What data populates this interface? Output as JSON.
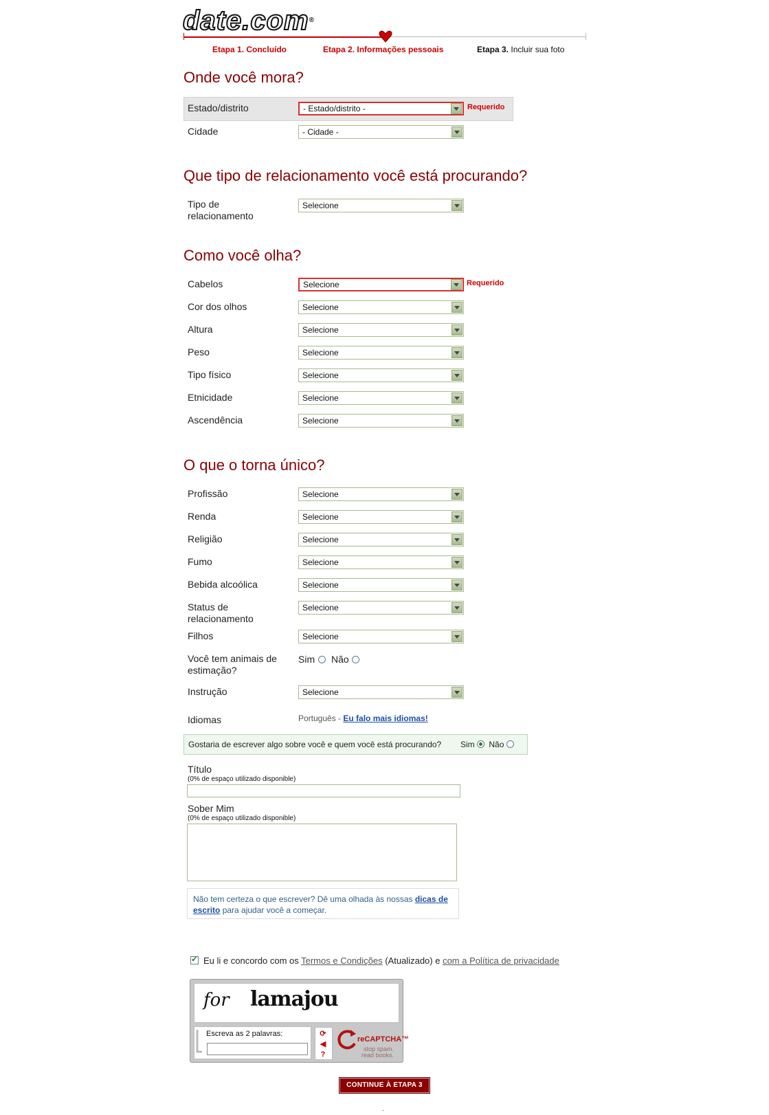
{
  "brand": {
    "logo_text": "date.com",
    "reg_mark": "®",
    "accent_color": "#8b0000",
    "error_color": "#d00000"
  },
  "steps": [
    {
      "label": "Etapa 1. Concluído"
    },
    {
      "label": "Etapa 2. Informações pessoais"
    },
    {
      "number": "Etapa 3.",
      "text": "Incluir sua foto"
    }
  ],
  "sections": {
    "location": "Onde você mora?",
    "relationship": "Que tipo de relacionamento você está procurando?",
    "looks": "Como você olha?",
    "unique": "O que o torna único?"
  },
  "location": {
    "state_label": "Estado/distrito",
    "state_value": "- Estado/distrito -",
    "state_required": "Requerido",
    "city_label": "Cidade",
    "city_value": "- Cidade -"
  },
  "relationship": {
    "type_label": "Tipo de relacionamento",
    "type_value": "Selecione"
  },
  "looks": {
    "required": "Requerido",
    "fields": [
      {
        "label": "Cabelos",
        "value": "Selecione"
      },
      {
        "label": "Cor dos olhos",
        "value": "Selecione"
      },
      {
        "label": "Altura",
        "value": "Selecione"
      },
      {
        "label": "Peso",
        "value": "Selecione"
      },
      {
        "label": "Tipo físico",
        "value": "Selecione"
      },
      {
        "label": "Etnicidade",
        "value": "Selecione"
      },
      {
        "label": "Ascendência",
        "value": "Selecione"
      }
    ]
  },
  "unique": {
    "fields": [
      {
        "label": "Profissão",
        "value": "Selecione"
      },
      {
        "label": "Renda",
        "value": "Selecione"
      },
      {
        "label": "Religião",
        "value": "Selecione"
      },
      {
        "label": "Fumo",
        "value": "Selecione"
      },
      {
        "label": "Bebida alcoólica",
        "value": "Selecione"
      },
      {
        "label": "Status de relacionamento",
        "value": "Selecione"
      },
      {
        "label": "Filhos",
        "value": "Selecione"
      }
    ],
    "pets_label": "Você tem animais de estimação?",
    "yes": "Sim",
    "no": "Não",
    "education_label": "Instrução",
    "education_value": "Selecione",
    "languages_label": "Idiomas",
    "languages_value": "Português - ",
    "languages_link": "Eu falo mais idiomas!"
  },
  "about": {
    "question": "Gostaria de escrever algo sobre você e quem você está procurando?",
    "yes": "Sim",
    "no": "Não",
    "title_label": "Título",
    "title_hint": "(0% de espaço utilizado disponible)",
    "aboutme_label": "Sober Mim",
    "aboutme_hint": "(0% de espaço utilizado disponible)",
    "tips_text_1": "Não tem certeza o que escrever? Dê uma olhada às nossas ",
    "tips_link": "dicas de escrito",
    "tips_text_2": " para ajudar você a começar."
  },
  "terms": {
    "text_1": "Eu li e concordo com os ",
    "terms_link": "Termos e Condições",
    "text_2": " (Atualizado) e ",
    "privacy_link": "com a Política de privacidade"
  },
  "captcha": {
    "word_1": "for",
    "word_2": "lamajou",
    "instruction": "Escreva as 2 palavras:",
    "brand": "reCAPTCHA™",
    "tagline_1": "stop spam.",
    "tagline_2": "read books."
  },
  "continue_label": "CONTINUE À ETAPA 3",
  "footer_mark": "·"
}
